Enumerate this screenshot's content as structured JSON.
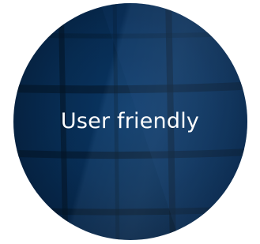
{
  "badge": {
    "label": "User friendly"
  },
  "colors": {
    "circle_fill": "#08305a",
    "text": "#ffffff",
    "background": "#ffffff"
  }
}
